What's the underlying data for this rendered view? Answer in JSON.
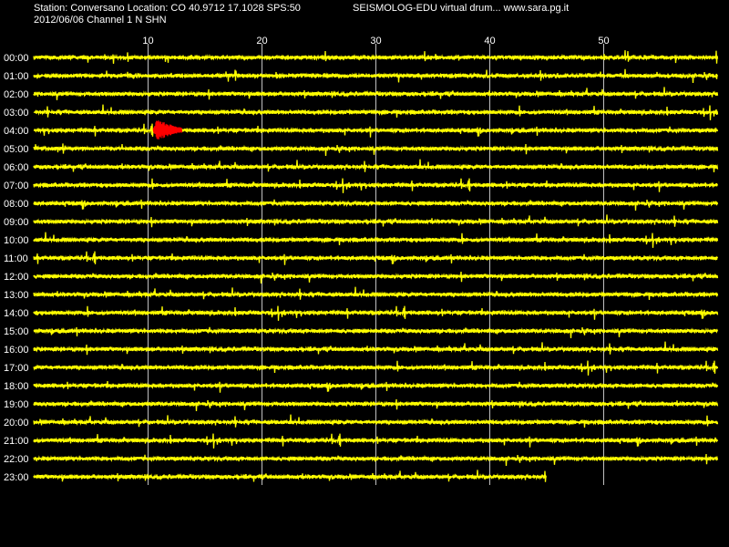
{
  "header": {
    "station_info": "Station: Conversano Location: CO 40.9712 17.1028 SPS:50",
    "date_channel": "2012/06/06  Channel 1 N SHN",
    "site_credit": "SEISMOLOG-EDU virtual drum... www.sara.pg.it"
  },
  "colors": {
    "background": "#000000",
    "trace": "#ffff00",
    "event": "#ff0000",
    "grid": "#c0c0c0",
    "text": "#ffffff"
  },
  "chart_data": {
    "type": "line",
    "x": {
      "unit": "minutes",
      "range": [
        0,
        60
      ],
      "ticks": [
        10,
        20,
        30,
        40,
        50
      ]
    },
    "rows": [
      {
        "label": "00:00"
      },
      {
        "label": "01:00"
      },
      {
        "label": "02:00"
      },
      {
        "label": "03:00"
      },
      {
        "label": "04:00"
      },
      {
        "label": "05:00"
      },
      {
        "label": "06:00"
      },
      {
        "label": "07:00"
      },
      {
        "label": "08:00"
      },
      {
        "label": "09:00"
      },
      {
        "label": "10:00"
      },
      {
        "label": "11:00"
      },
      {
        "label": "12:00"
      },
      {
        "label": "13:00"
      },
      {
        "label": "14:00"
      },
      {
        "label": "15:00"
      },
      {
        "label": "16:00"
      },
      {
        "label": "17:00"
      },
      {
        "label": "18:00"
      },
      {
        "label": "19:00"
      },
      {
        "label": "20:00"
      },
      {
        "label": "21:00"
      },
      {
        "label": "22:00"
      },
      {
        "label": "23:00",
        "end_minute": 45
      }
    ],
    "events": [
      {
        "row": "04:00",
        "start_minute": 10.5,
        "end_minute": 13
      }
    ],
    "grid": true
  }
}
